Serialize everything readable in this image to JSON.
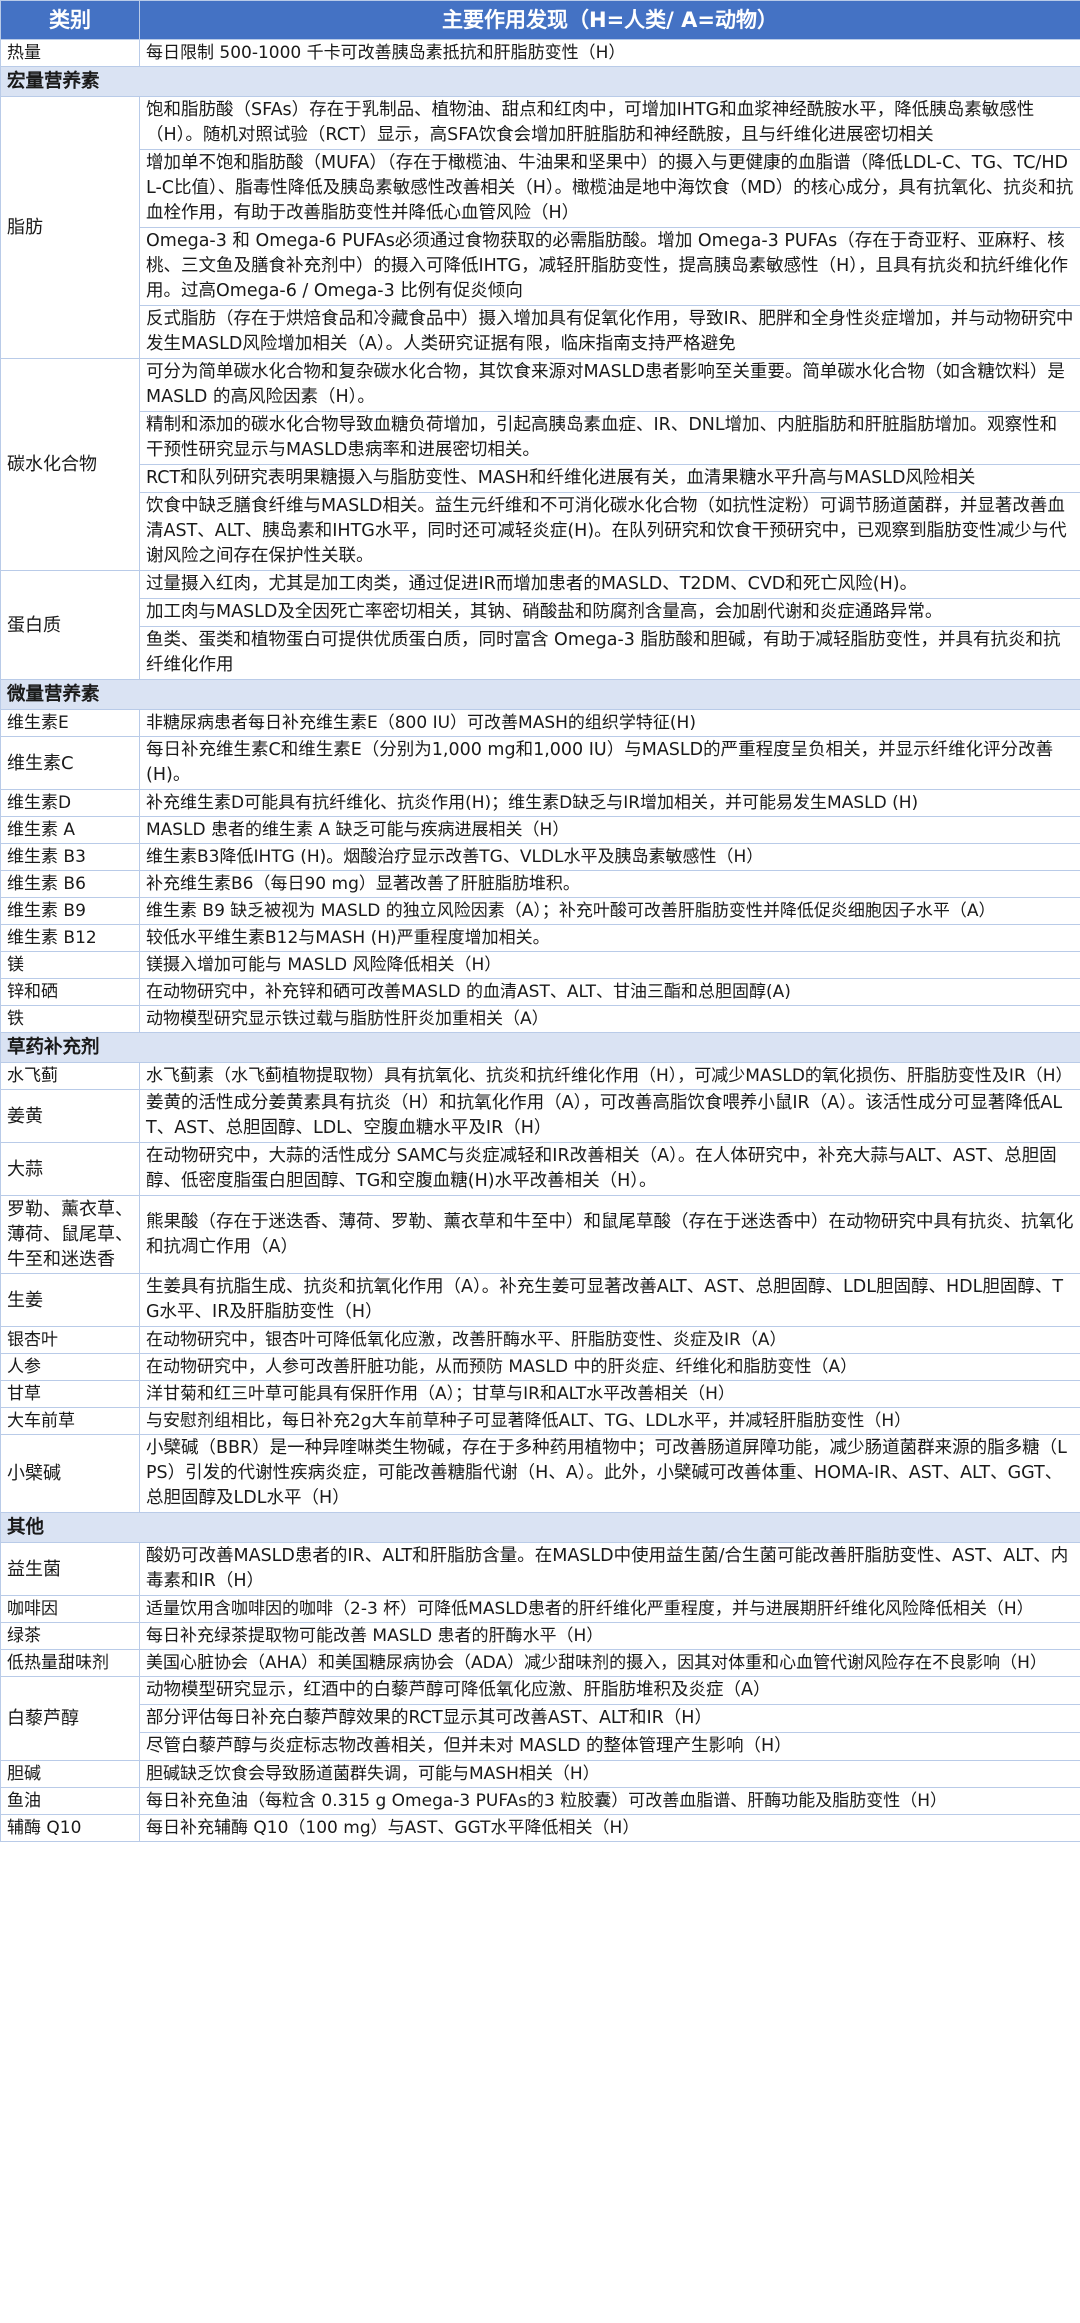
{
  "header": {
    "col1": "类别",
    "col2": "主要作用发现（H=人类/ A=动物）"
  },
  "groups": [
    {
      "section": null,
      "rows": [
        {
          "cat": "热量",
          "lines": [
            "每日限制 500-1000 千卡可改善胰岛素抵抗和肝脂肪变性（H）"
          ]
        }
      ]
    },
    {
      "section": "宏量营养素",
      "rows": [
        {
          "cat": "脂肪",
          "lines": [
            "饱和脂肪酸（SFAs）存在于乳制品、植物油、甜点和红肉中，可增加IHTG和血浆神经酰胺水平，降低胰岛素敏感性（H）。随机对照试验（RCT）显示，高SFA饮食会增加肝脏脂肪和神经酰胺，且与纤维化进展密切相关",
            "增加单不饱和脂肪酸（MUFA）（存在于橄榄油、牛油果和坚果中）的摄入与更健康的血脂谱（降低LDL-C、TG、TC/HDL-C比值）、脂毒性降低及胰岛素敏感性改善相关（H）。橄榄油是地中海饮食（MD）的核心成分，具有抗氧化、抗炎和抗血栓作用，有助于改善脂肪变性并降低心血管风险（H）",
            "Omega-3 和 Omega-6 PUFAs必须通过食物获取的必需脂肪酸。增加 Omega-3 PUFAs（存在于奇亚籽、亚麻籽、核桃、三文鱼及膳食补充剂中）的摄入可降低IHTG，减轻肝脂肪变性，提高胰岛素敏感性（H），且具有抗炎和抗纤维化作用。过高Omega-6 / Omega-3 比例有促炎倾向",
            "反式脂肪（存在于烘焙食品和冷藏食品中）摄入增加具有促氧化作用，导致IR、肥胖和全身性炎症增加，并与动物研究中发生MASLD风险增加相关（A）。人类研究证据有限，临床指南支持严格避免"
          ]
        },
        {
          "cat": "碳水化合物",
          "lines": [
            "可分为简单碳水化合物和复杂碳水化合物，其饮食来源对MASLD患者影响至关重要。简单碳水化合物（如含糖饮料）是 MASLD 的高风险因素（H）。",
            "精制和添加的碳水化合物导致血糖负荷增加，引起高胰岛素血症、IR、DNL增加、内脏脂肪和肝脏脂肪增加。观察性和干预性研究显示与MASLD患病率和进展密切相关。",
            "RCT和队列研究表明果糖摄入与脂肪变性、MASH和纤维化进展有关，血清果糖水平升高与MASLD风险相关",
            "饮食中缺乏膳食纤维与MASLD相关。益生元纤维和不可消化碳水化合物（如抗性淀粉）可调节肠道菌群，并显著改善血清AST、ALT、胰岛素和IHTG水平，同时还可减轻炎症(H)。在队列研究和饮食干预研究中，已观察到脂肪变性减少与代谢风险之间存在保护性关联。"
          ]
        },
        {
          "cat": "蛋白质",
          "lines": [
            "过量摄入红肉，尤其是加工肉类，通过促进IR而增加患者的MASLD、T2DM、CVD和死亡风险(H)。",
            "加工肉与MASLD及全因死亡率密切相关，其钠、硝酸盐和防腐剂含量高，会加剧代谢和炎症通路异常。",
            "鱼类、蛋类和植物蛋白可提供优质蛋白质，同时富含 Omega-3 脂肪酸和胆碱，有助于减轻脂肪变性，并具有抗炎和抗纤维化作用"
          ]
        }
      ]
    },
    {
      "section": "微量营养素",
      "rows": [
        {
          "cat": "维生素E",
          "lines": [
            "非糖尿病患者每日补充维生素E（800 IU）可改善MASH的组织学特征(H)"
          ]
        },
        {
          "cat": "维生素C",
          "lines": [
            "每日补充维生素C和维生素E（分别为1,000 mg和1,000 IU）与MASLD的严重程度呈负相关，并显示纤维化评分改善(H)。"
          ]
        },
        {
          "cat": "维生素D",
          "lines": [
            "补充维生素D可能具有抗纤维化、抗炎作用(H)；维生素D缺乏与IR增加相关，并可能易发生MASLD (H)"
          ]
        },
        {
          "cat": "维生素 A",
          "lines": [
            "MASLD 患者的维生素 A 缺乏可能与疾病进展相关（H）"
          ]
        },
        {
          "cat": "维生素 B3",
          "lines": [
            "维生素B3降低IHTG (H)。烟酸治疗显示改善TG、VLDL水平及胰岛素敏感性（H）"
          ]
        },
        {
          "cat": "维生素 B6",
          "lines": [
            "补充维生素B6（每日90 mg）显著改善了肝脏脂肪堆积。"
          ]
        },
        {
          "cat": "维生素 B9",
          "lines": [
            "维生素 B9 缺乏被视为 MASLD 的独立风险因素（A）；补充叶酸可改善肝脂肪变性并降低促炎细胞因子水平（A）"
          ]
        },
        {
          "cat": "维生素 B12",
          "lines": [
            "较低水平维生素B12与MASH (H)严重程度增加相关。"
          ]
        },
        {
          "cat": "镁",
          "lines": [
            "镁摄入增加可能与 MASLD 风险降低相关（H）"
          ]
        },
        {
          "cat": "锌和硒",
          "lines": [
            "在动物研究中，补充锌和硒可改善MASLD 的血清AST、ALT、甘油三酯和总胆固醇(A)"
          ]
        },
        {
          "cat": "铁",
          "lines": [
            "动物模型研究显示铁过载与脂肪性肝炎加重相关（A）"
          ]
        }
      ]
    },
    {
      "section": "草药补充剂",
      "rows": [
        {
          "cat": "水飞蓟",
          "lines": [
            "水飞蓟素（水飞蓟植物提取物）具有抗氧化、抗炎和抗纤维化作用（H），可减少MASLD的氧化损伤、肝脂肪变性及IR（H）"
          ]
        },
        {
          "cat": "姜黄",
          "lines": [
            "姜黄的活性成分姜黄素具有抗炎（H）和抗氧化作用（A），可改善高脂饮食喂养小鼠IR（A）。该活性成分可显著降低ALT、AST、总胆固醇、LDL、空腹血糖水平及IR（H）"
          ]
        },
        {
          "cat": "大蒜",
          "lines": [
            "在动物研究中，大蒜的活性成分 SAMC与炎症减轻和IR改善相关（A）。在人体研究中，补充大蒜与ALT、AST、总胆固醇、低密度脂蛋白胆固醇、TG和空腹血糖(H)水平改善相关（H）。"
          ]
        },
        {
          "cat": "罗勒、薰衣草、薄荷、鼠尾草、牛至和迷迭香",
          "lines": [
            "熊果酸（存在于迷迭香、薄荷、罗勒、薰衣草和牛至中）和鼠尾草酸（存在于迷迭香中）在动物研究中具有抗炎、抗氧化和抗凋亡作用（A）"
          ]
        },
        {
          "cat": "生姜",
          "lines": [
            "生姜具有抗脂生成、抗炎和抗氧化作用（A）。补充生姜可显著改善ALT、AST、总胆固醇、LDL胆固醇、HDL胆固醇、TG水平、IR及肝脂肪变性（H）"
          ]
        },
        {
          "cat": "银杏叶",
          "lines": [
            "在动物研究中，银杏叶可降低氧化应激，改善肝酶水平、肝脂肪变性、炎症及IR（A）"
          ]
        },
        {
          "cat": "人参",
          "lines": [
            "在动物研究中，人参可改善肝脏功能，从而预防 MASLD 中的肝炎症、纤维化和脂肪变性（A）"
          ]
        },
        {
          "cat": "甘草",
          "lines": [
            "洋甘菊和红三叶草可能具有保肝作用（A）；甘草与IR和ALT水平改善相关（H）"
          ]
        },
        {
          "cat": "大车前草",
          "lines": [
            "与安慰剂组相比，每日补充2g大车前草种子可显著降低ALT、TG、LDL水平，并减轻肝脂肪变性（H）"
          ]
        },
        {
          "cat": "小檗碱",
          "lines": [
            "小檗碱（BBR）是一种异喹啉类生物碱，存在于多种药用植物中；可改善肠道屏障功能，减少肠道菌群来源的脂多糖（LPS）引发的代谢性疾病炎症，可能改善糖脂代谢（H、A）。此外，小檗碱可改善体重、HOMA-IR、AST、ALT、GGT、总胆固醇及LDL水平（H）"
          ]
        }
      ]
    },
    {
      "section": "其他",
      "rows": [
        {
          "cat": "益生菌",
          "lines": [
            "酸奶可改善MASLD患者的IR、ALT和肝脂肪含量。在MASLD中使用益生菌/合生菌可能改善肝脂肪变性、AST、ALT、内毒素和IR（H）"
          ]
        },
        {
          "cat": "咖啡因",
          "lines": [
            "适量饮用含咖啡因的咖啡（2-3 杯）可降低MASLD患者的肝纤维化严重程度，并与进展期肝纤维化风险降低相关（H）"
          ]
        },
        {
          "cat": "绿茶",
          "lines": [
            "每日补充绿茶提取物可能改善 MASLD 患者的肝酶水平（H）"
          ]
        },
        {
          "cat": "低热量甜味剂",
          "lines": [
            "美国心脏协会（AHA）和美国糖尿病协会（ADA）减少甜味剂的摄入，因其对体重和心血管代谢风险存在不良影响（H）"
          ]
        },
        {
          "cat": "白藜芦醇",
          "lines": [
            "动物模型研究显示，红酒中的白藜芦醇可降低氧化应激、肝脂肪堆积及炎症（A）",
            "部分评估每日补充白藜芦醇效果的RCT显示其可改善AST、ALT和IR（H）",
            "尽管白藜芦醇与炎症标志物改善相关，但并未对 MASLD 的整体管理产生影响（H）"
          ]
        },
        {
          "cat": "胆碱",
          "lines": [
            "胆碱缺乏饮食会导致肠道菌群失调，可能与MASH相关（H）"
          ]
        },
        {
          "cat": "鱼油",
          "lines": [
            "每日补充鱼油（每粒含 0.315 g Omega-3 PUFAs的3 粒胶囊）可改善血脂谱、肝酶功能及脂肪变性（H）"
          ]
        },
        {
          "cat": "辅酶 Q10",
          "lines": [
            "每日补充辅酶 Q10（100 mg）与AST、GGT水平降低相关（H）"
          ]
        }
      ]
    }
  ]
}
